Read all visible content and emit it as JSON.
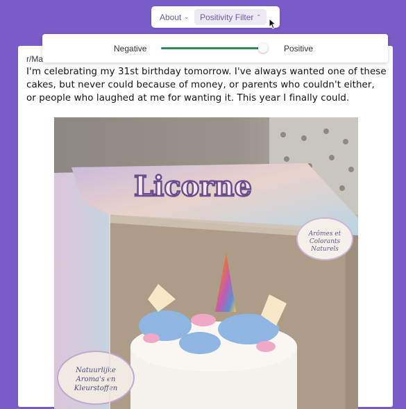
{
  "nav": {
    "about_label": "About",
    "filter_label": "Positivity Filter",
    "about_icon": "chevron-down-icon",
    "filter_icon": "chevron-up-icon"
  },
  "filter": {
    "negative_label": "Negative",
    "positive_label": "Positive",
    "value": 0.98
  },
  "post": {
    "subreddit": "r/Mademeamile",
    "text": "I'm celebrating my 31st birthday tomorrow. I've always wanted one of these cakes, but never could because of money, or parents who couldn't either, or people who laughed at me for wanting it. This year I finally could.",
    "image": {
      "box_title": "Licorne",
      "badge_right": "Arômes et Colorants Naturels",
      "badge_left": "Natuurlijke Aroma's en Kleurstoffen"
    }
  },
  "colors": {
    "page_background": "#7a5cc8",
    "slider_fill": "#2f8a55",
    "nav_text": "#6b5aa6"
  }
}
